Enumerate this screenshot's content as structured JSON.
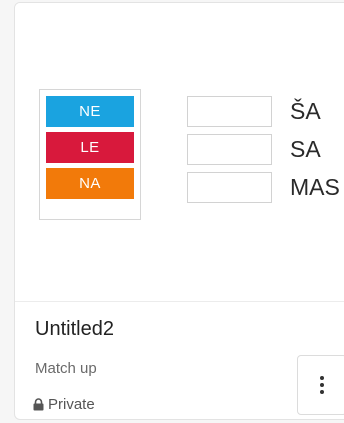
{
  "preview": {
    "labels": [
      {
        "text": "NE",
        "color": "#1aa3e0"
      },
      {
        "text": "LE",
        "color": "#d8193c"
      },
      {
        "text": "NA",
        "color": "#f27a0a"
      }
    ],
    "targets": [
      "ŠA",
      "SA",
      "MAS"
    ]
  },
  "card": {
    "title": "Untitled2",
    "type": "Match up",
    "privacy": "Private"
  },
  "icons": {
    "lock": "lock-icon",
    "menu": "more-vertical-icon"
  }
}
